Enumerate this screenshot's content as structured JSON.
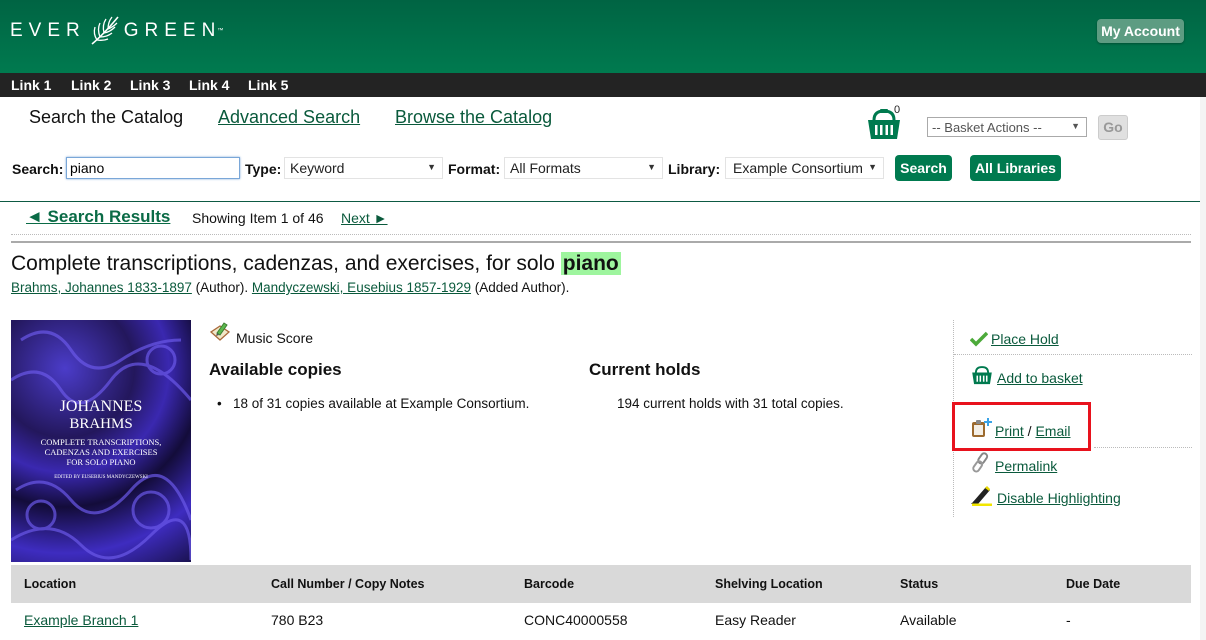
{
  "header": {
    "logo_left": "EVER",
    "logo_right": "GREEN",
    "logo_tm": "™",
    "my_account": "My Account",
    "brand_color": "#007a4f"
  },
  "topnav": [
    "Link 1",
    "Link 2",
    "Link 3",
    "Link 4",
    "Link 5"
  ],
  "search_tabs": {
    "current": "Search the Catalog",
    "advanced": "Advanced Search",
    "browse": "Browse the Catalog"
  },
  "basket": {
    "count": "0",
    "actions_placeholder": "-- Basket Actions --",
    "go": "Go"
  },
  "search": {
    "search_label": "Search:",
    "query": "piano",
    "type_label": "Type:",
    "type_value": "Keyword",
    "format_label": "Format:",
    "format_value": "All Formats",
    "library_label": "Library:",
    "library_value": "Example Consortium",
    "search_button": "Search",
    "all_libraries_button": "All Libraries"
  },
  "results_nav": {
    "back": "◄ Search Results",
    "showing": "Showing Item 1 of 46",
    "next": "Next ►"
  },
  "record": {
    "title_prefix": "Complete transcriptions, cadenzas, and exercises, for solo ",
    "title_highlight": "piano",
    "author1": "Brahms, Johannes 1833-1897",
    "author1_role": " (Author). ",
    "author2": "Mandyczewski, Eusebius 1857-1929",
    "author2_role": " (Added Author).",
    "cover": {
      "line1": "JOHANNES",
      "line2": "BRAHMS",
      "line3": "COMPLETE TRANSCRIPTIONS,",
      "line4": "CADENZAS AND EXERCISES",
      "line5": "FOR SOLO PIANO",
      "line6": "EDITED BY EUSEBIUS MANDYCZEWSKI"
    },
    "format": "Music Score",
    "available_heading": "Available copies",
    "available_text": "18 of 31 copies available at Example Consortium.",
    "holds_heading": "Current holds",
    "holds_text": "194 current holds with 31 total copies."
  },
  "actions": {
    "place_hold": "Place Hold",
    "add_to_basket": "Add to basket",
    "print": "Print",
    "slash": " / ",
    "email": "Email",
    "permalink": "Permalink",
    "disable_highlighting": "Disable Highlighting"
  },
  "holdings": {
    "columns": [
      "Location",
      "Call Number / Copy Notes",
      "Barcode",
      "Shelving Location",
      "Status",
      "Due Date"
    ],
    "rows": [
      [
        "Example Branch 1",
        "780 B23",
        "CONC40000558",
        "Easy Reader",
        "Available",
        "-"
      ]
    ]
  }
}
